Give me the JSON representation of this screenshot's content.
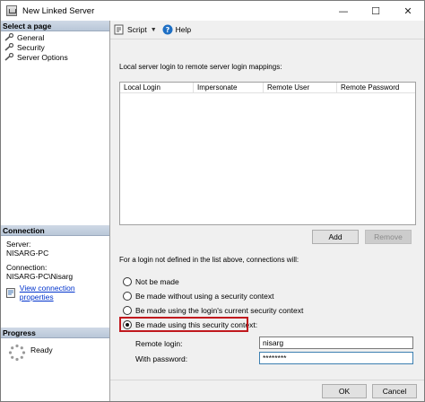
{
  "window": {
    "title": "New Linked Server",
    "minimize": "—",
    "maximize": "☐",
    "close": "✕"
  },
  "left": {
    "select_page_header": "Select a page",
    "pages": [
      {
        "label": "General"
      },
      {
        "label": "Security"
      },
      {
        "label": "Server Options"
      }
    ],
    "connection_header": "Connection",
    "server_label": "Server:",
    "server_value": "NISARG-PC",
    "connection_label": "Connection:",
    "connection_value": "NISARG-PC\\Nisarg",
    "view_props_link": "View connection properties",
    "progress_header": "Progress",
    "progress_status": "Ready"
  },
  "toolbar": {
    "script_label": "Script",
    "help_label": "Help"
  },
  "mappings": {
    "label": "Local server login to remote server login mappings:",
    "columns": [
      "Local Login",
      "Impersonate",
      "Remote User",
      "Remote Password"
    ],
    "add_label": "Add",
    "remove_label": "Remove"
  },
  "policy": {
    "description": "For a login not defined in the list above, connections will:",
    "options": [
      {
        "label": "Not be made",
        "checked": false
      },
      {
        "label": "Be made without using a security context",
        "checked": false
      },
      {
        "label": "Be made using the login's current security context",
        "checked": false
      },
      {
        "label": "Be made using this security context:",
        "checked": true
      }
    ],
    "remote_login_label": "Remote login:",
    "remote_login_value": "nisarg",
    "password_label": "With password:",
    "password_value": "********"
  },
  "footer": {
    "ok_label": "OK",
    "cancel_label": "Cancel"
  },
  "colors": {
    "highlight": "#c0191e",
    "link": "#0033cc",
    "pane_header": "#c3cfdf"
  }
}
